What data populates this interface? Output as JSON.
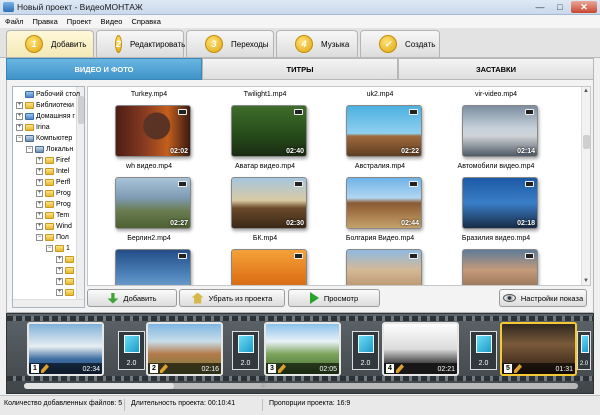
{
  "window": {
    "title": "Новый проект - ВидеоМОНТАЖ",
    "close_glyph": "✕",
    "minimize_glyph": "—",
    "maximize_glyph": "□"
  },
  "menu": [
    "Файл",
    "Правка",
    "Проект",
    "Видео",
    "Справка"
  ],
  "steps": [
    {
      "num": "1",
      "label": "Добавить"
    },
    {
      "num": "2",
      "label": "Редактировать"
    },
    {
      "num": "3",
      "label": "Переходы"
    },
    {
      "num": "4",
      "label": "Музыка"
    },
    {
      "num": "✓",
      "label": "Создать"
    }
  ],
  "subtabs": [
    "ВИДЕО И ФОТО",
    "ТИТРЫ",
    "ЗАСТАВКИ"
  ],
  "tree": [
    {
      "label": "Рабочий стол",
      "exp": "",
      "icon": "blue"
    },
    {
      "label": "Библиотеки",
      "exp": "+",
      "icon": "folder"
    },
    {
      "label": "Домашняя г",
      "exp": "+",
      "icon": "blue"
    },
    {
      "label": "Irina",
      "exp": "+",
      "icon": "folder"
    },
    {
      "label": "Компьютер",
      "exp": "−",
      "icon": "pc"
    },
    {
      "label": "Локальн",
      "exp": "−",
      "icon": "pc"
    },
    {
      "label": "Firef",
      "exp": "+",
      "icon": "folder"
    },
    {
      "label": "Intel",
      "exp": "+",
      "icon": "folder"
    },
    {
      "label": "Perfl",
      "exp": "+",
      "icon": "folder"
    },
    {
      "label": "Prog",
      "exp": "+",
      "icon": "folder"
    },
    {
      "label": "Prog",
      "exp": "+",
      "icon": "folder"
    },
    {
      "label": "Tem",
      "exp": "+",
      "icon": "folder"
    },
    {
      "label": "Wind",
      "exp": "+",
      "icon": "folder"
    },
    {
      "label": "Пол",
      "exp": "−",
      "icon": "folder"
    },
    {
      "label": "1",
      "exp": "−",
      "icon": "folder"
    },
    {
      "label": "",
      "exp": "+",
      "icon": "folder"
    },
    {
      "label": "",
      "exp": "+",
      "icon": "folder"
    },
    {
      "label": "",
      "exp": "+",
      "icon": "folder"
    },
    {
      "label": "",
      "exp": "+",
      "icon": "folder"
    }
  ],
  "files": [
    {
      "name": "Turkey.mp4",
      "duration": "02:02"
    },
    {
      "name": "Twilight1.mp4",
      "duration": "02:40"
    },
    {
      "name": "uk2.mp4",
      "duration": "02:22"
    },
    {
      "name": "vir-video.mp4",
      "duration": "02:14"
    },
    {
      "name": "wh видео.mp4",
      "duration": "02:27"
    },
    {
      "name": "Аватар видео.mp4",
      "duration": "02:30"
    },
    {
      "name": "Австралия.mp4",
      "duration": "02:44"
    },
    {
      "name": "Автомобили видео.mp4",
      "duration": "02:18"
    },
    {
      "name": "Берлин2.mp4",
      "duration": ""
    },
    {
      "name": "БК.mp4",
      "duration": ""
    },
    {
      "name": "Болгария Видео.mp4",
      "duration": ""
    },
    {
      "name": "Бразилия видео.mp4",
      "duration": ""
    }
  ],
  "buttons": {
    "add": "Добавить",
    "remove": "Убрать из проекта",
    "preview": "Просмотр",
    "settings": "Настройки показа"
  },
  "timeline": {
    "slides": [
      {
        "idx": "1",
        "duration": "02:34"
      },
      {
        "idx": "2",
        "duration": "02:16"
      },
      {
        "idx": "3",
        "duration": "02:05"
      },
      {
        "idx": "4",
        "duration": "02:21"
      },
      {
        "idx": "5",
        "duration": "01:31"
      }
    ],
    "transitions": [
      "2.0",
      "2.0",
      "2.0",
      "2.0",
      "2.0"
    ],
    "next_glyph": "›",
    "grip_glyph": "⁞⁞⁞"
  },
  "status": {
    "files_count": "Количество добавленных файлов: 5",
    "duration": "Длительность проекта:  00:10:41",
    "proportions": "Пропорции проекта: 16:9"
  },
  "colors": {
    "accent_tab": "#3f93c9",
    "step_active": "#f3e9b8",
    "selected_slide": "#f6c833"
  }
}
